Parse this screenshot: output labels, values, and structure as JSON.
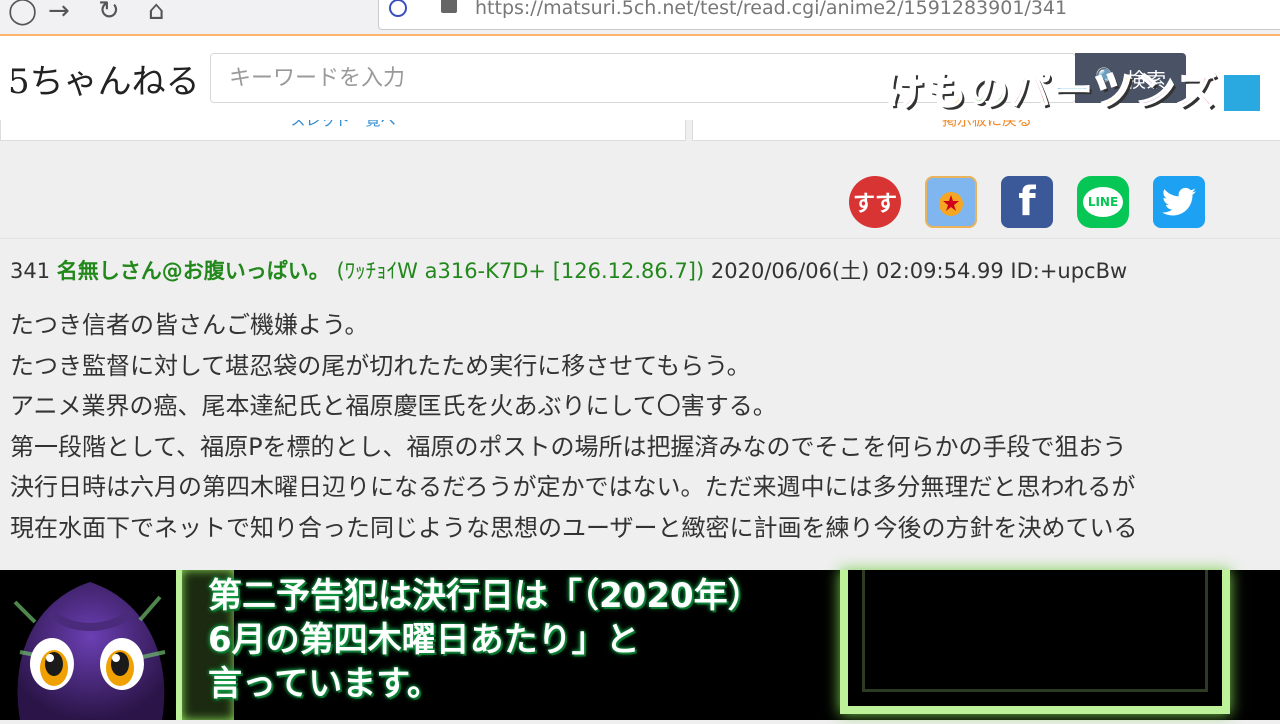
{
  "browser": {
    "url": "https://matsuri.5ch.net/test/read.cgi/anime2/1591283901/341"
  },
  "site": {
    "logo_text": "5ちゃんねる",
    "search_placeholder": "キーワードを入力",
    "search_button": "検索",
    "overlay_logo": "けものパーツンズ",
    "board_button_left": "スレッド一覧へ",
    "board_button_right": "掲示板に戻る"
  },
  "share": {
    "icons": [
      "susu-icon",
      "matome-icon",
      "facebook-icon",
      "line-icon",
      "twitter-icon"
    ],
    "colors": {
      "susu": "#d93434",
      "facebook": "#3b5998",
      "line": "#06c755",
      "twitter": "#1da1f2"
    }
  },
  "post": {
    "number": "341",
    "name": "名無しさん@お腹いっぱい。",
    "trip": "(ﾜｯﾁｮｲW a316-K7D+ [126.12.86.7])",
    "date": "2020/06/06(土) 02:09:54.99 ID:+upcBw",
    "lines": [
      "たつき信者の皆さんご機嫌よう。",
      "たつき監督に対して堪忍袋の尾が切れたため実行に移させてもらう。",
      "アニメ業界の癌、尾本達紀氏と福原慶匡氏を火あぶりにして〇害する。",
      "第一段階として、福原Pを標的とし、福原のポストの場所は把握済みなのでそこを何らかの手段で狙おう",
      "決行日時は六月の第四木曜日辺りになるだろうが定かではない。ただ来週中には多分無理だと思われるが",
      "現在水面下でネットで知り合った同じような思想のユーザーと緻密に計画を練り今後の方針を決めている"
    ]
  },
  "caption": {
    "lines": [
      "第二予告犯は決行日は「（2020年）",
      "6月の第四木曜日あたり」と",
      "言っています。"
    ],
    "text_color": "#ffffff",
    "glow_color": "#16a34a"
  }
}
